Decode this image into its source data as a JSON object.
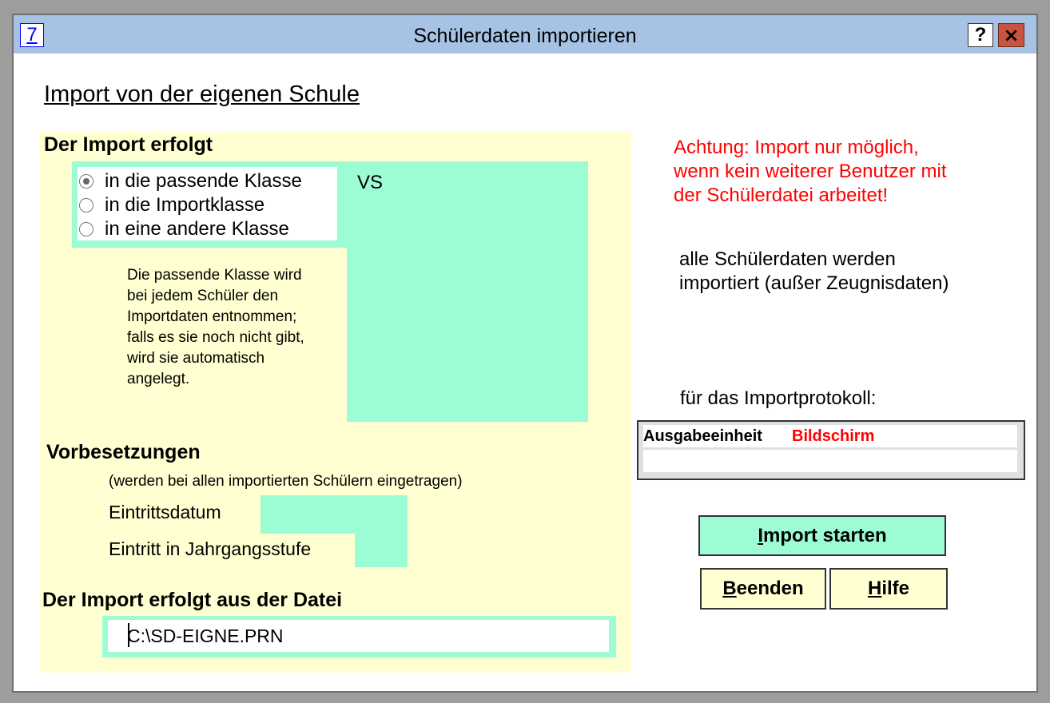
{
  "window": {
    "title": "Schülerdaten importieren",
    "app_icon_label": "7",
    "help_label": "?",
    "close_label": "×"
  },
  "heading": "Import von der eigenen Schule",
  "import_target": {
    "title": "Der Import erfolgt",
    "options": [
      "in die passende Klasse",
      "in die Importklasse",
      "in eine andere Klasse"
    ],
    "selected_index": 0,
    "class_value": "VS",
    "note_lines": [
      "Die passende Klasse wird",
      "bei jedem Schüler den",
      "Importdaten entnommen;",
      "falls es sie noch nicht gibt,",
      "wird sie automatisch",
      "angelegt."
    ]
  },
  "warning_lines": [
    "Achtung: Import nur möglich,",
    "wenn kein weiterer Benutzer mit",
    "der Schülerdatei arbeitet!"
  ],
  "info_lines": [
    "alle Schülerdaten werden",
    "importiert (außer Zeugnisdaten)"
  ],
  "protocol": {
    "label": "für das Importprotokoll:",
    "output_label": "Ausgabeeinheit",
    "output_value": "Bildschirm"
  },
  "defaults": {
    "title": "Vorbesetzungen",
    "subtitle": "(werden bei allen importierten Schülern eingetragen)",
    "entry_date_label": "Eintrittsdatum",
    "entry_date_value": "",
    "grade_label": "Eintritt in Jahrgangsstufe",
    "grade_value": ""
  },
  "file": {
    "title": "Der Import erfolgt aus der Datei",
    "path": "C:\\SD-EIGNE.PRN"
  },
  "buttons": {
    "start_mnemonic": "I",
    "start_rest": "mport starten",
    "end_mnemonic": "B",
    "end_rest": "eenden",
    "help_mnemonic": "H",
    "help_rest": "ilfe"
  },
  "colors": {
    "title_bar": "#a6c3e6",
    "panel_yellow": "#ffffd1",
    "field_green": "#9cfcd4",
    "warning_red": "#ff0000",
    "close_red": "#c8533e"
  }
}
